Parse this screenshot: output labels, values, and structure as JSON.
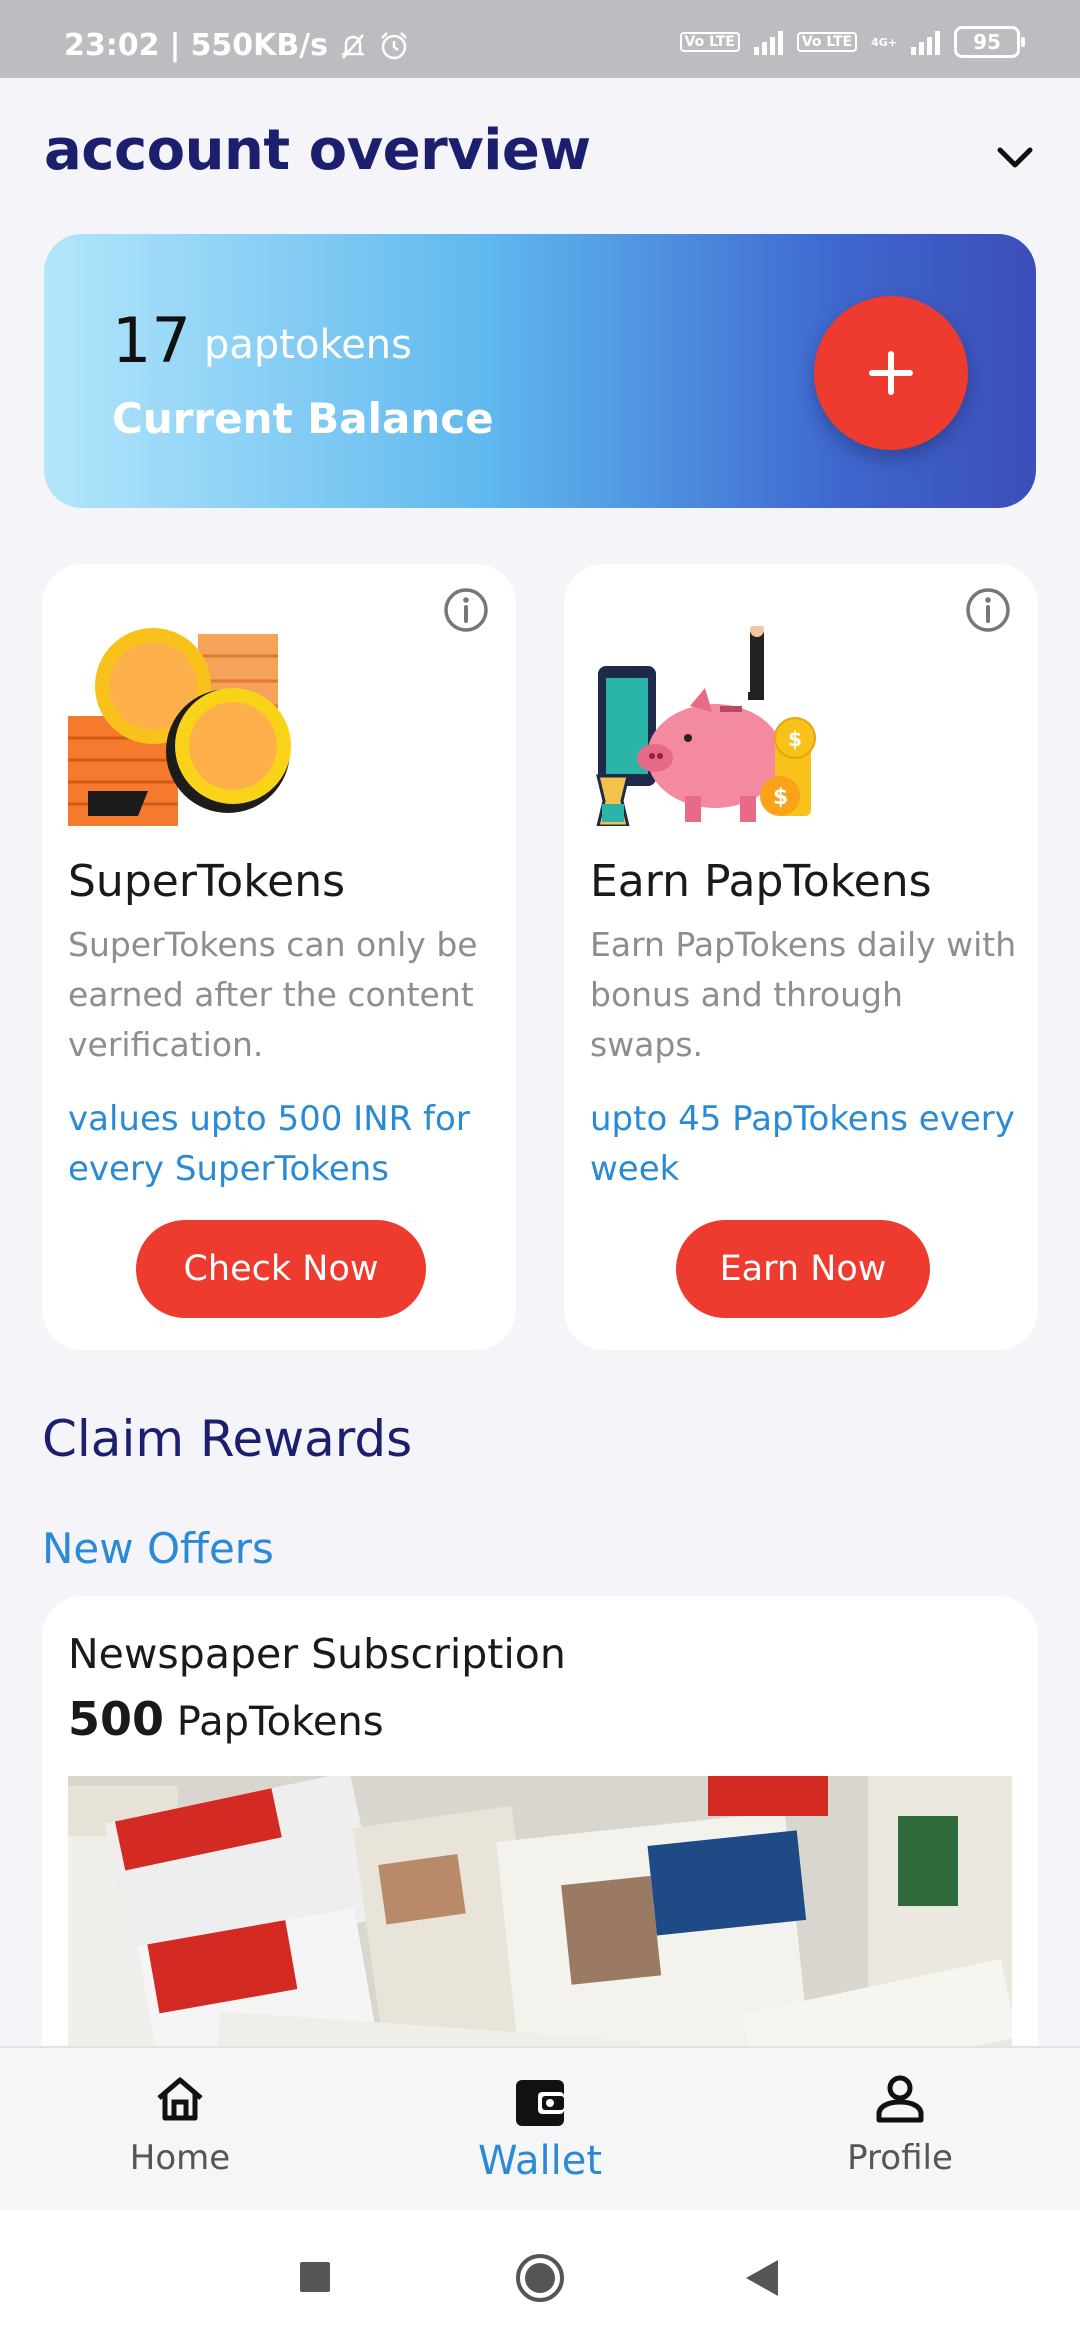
{
  "status_bar": {
    "time": "23:02",
    "speed": "550KB/s",
    "battery": "95",
    "volte1": "Vo LTE",
    "volte2": "Vo LTE",
    "network": "4G+"
  },
  "header": {
    "title": "account overview"
  },
  "balance": {
    "amount": "17",
    "unit": "paptokens",
    "label": "Current Balance"
  },
  "cards": [
    {
      "title": "SuperTokens",
      "description": "SuperTokens can only be earned after the content verification.",
      "highlight": "values upto 500 INR for every SuperTokens",
      "button": "Check Now"
    },
    {
      "title": "Earn PapTokens",
      "description": "Earn PapTokens daily with bonus and through swaps.",
      "highlight": "upto 45 PapTokens every week",
      "button": "Earn Now"
    }
  ],
  "rewards": {
    "section_title": "Claim Rewards",
    "subsection_title": "New Offers",
    "offers": [
      {
        "name": "Newspaper Subscription",
        "price": "500",
        "price_unit": "PapTokens"
      }
    ]
  },
  "bottom_nav": [
    {
      "label": "Home",
      "icon": "home-icon",
      "active": false
    },
    {
      "label": "Wallet",
      "icon": "wallet-icon",
      "active": true
    },
    {
      "label": "Profile",
      "icon": "profile-icon",
      "active": false
    }
  ],
  "colors": {
    "accent_red": "#ee3b2f",
    "accent_blue": "#2a8ad6",
    "title_navy": "#1b1f6e"
  }
}
